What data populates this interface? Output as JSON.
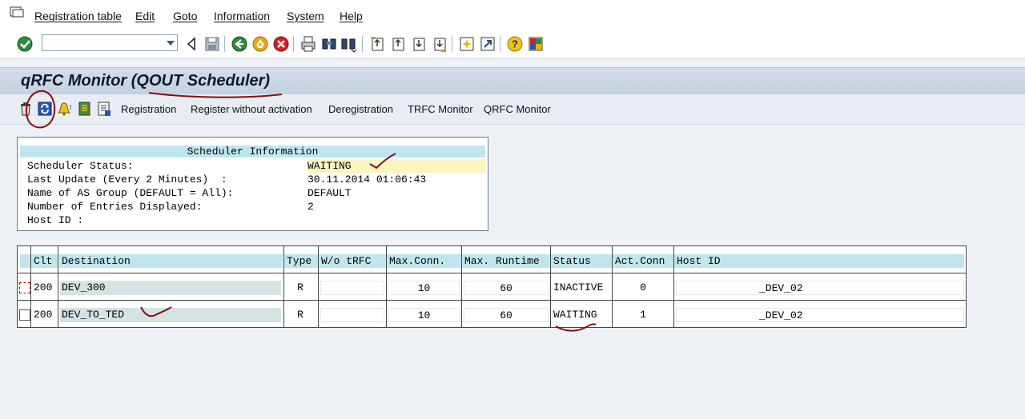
{
  "menu": [
    "Registration table",
    "Edit",
    "Goto",
    "Information",
    "System",
    "Help"
  ],
  "command_field": {
    "value": ""
  },
  "title": "qRFC Monitor (QOUT Scheduler)",
  "app_toolbar": {
    "buttons": [
      "Registration",
      "Register without activation",
      "Deregistration",
      "TRFC Monitor",
      "QRFC Monitor"
    ]
  },
  "scheduler_info": {
    "heading": "Scheduler Information",
    "rows": [
      {
        "label": "Scheduler Status:",
        "value": "WAITING"
      },
      {
        "label": "Last Update (Every 2 Minutes)  :",
        "value": "30.11.2014 01:06:43"
      },
      {
        "label": "Name of AS Group (DEFAULT = All):",
        "value": "DEFAULT"
      },
      {
        "label": "Number of Entries Displayed:",
        "value": "2"
      },
      {
        "label": "Host ID :",
        "value": ""
      }
    ]
  },
  "table": {
    "columns": [
      "Clt",
      "Destination",
      "Type",
      "W/o tRFC",
      "Max.Conn.",
      "Max. Runtime",
      "Status",
      "Act.Conn",
      "Host ID"
    ],
    "rows": [
      {
        "clt": "200",
        "destination": "DEV_300",
        "type": "R",
        "wo_trfc": "",
        "max_conn": "10",
        "max_runtime": "60",
        "status": "INACTIVE",
        "act_conn": "0",
        "host_id": "_DEV_02"
      },
      {
        "clt": "200",
        "destination": "DEV_TO_TED",
        "type": "R",
        "wo_trfc": "",
        "max_conn": "10",
        "max_runtime": "60",
        "status": "WAITING",
        "act_conn": "1",
        "host_id": "_DEV_02"
      }
    ]
  },
  "colors": {
    "header_cyan": "#bfe6ef",
    "highlight_yellow": "#fbf5c0",
    "annotation_red": "#8b0d0d"
  },
  "icons": [
    "enter-check-icon",
    "back-icon",
    "save-icon",
    "exit-icon",
    "cancel-icon",
    "print-icon",
    "find-icon",
    "find-next-icon",
    "first-page-icon",
    "previous-page-icon",
    "next-page-icon",
    "last-page-icon",
    "new-session-icon",
    "shortcut-icon",
    "help-icon",
    "layout-icon",
    "delete-icon",
    "refresh-icon",
    "alert-bell-icon",
    "display-icon",
    "details-icon"
  ]
}
